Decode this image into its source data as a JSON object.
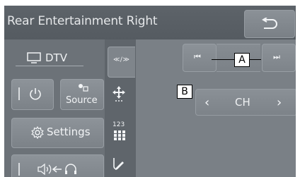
{
  "header": {
    "title": "Rear Entertainment Right",
    "back_icon": "return-arrow-icon"
  },
  "left_panel": {
    "source_name": "DTV",
    "source_icon": "monitor-icon",
    "power_icon": "power-icon",
    "source_button_label": "Source",
    "settings_label": "Settings",
    "settings_icon": "gear-icon",
    "audio_icon": "speaker-to-headphones-icon"
  },
  "middle_column": {
    "active_tab_label": "≪/≫",
    "move_icon": "move-arrows-icon",
    "keypad_label": "123",
    "edit_icon": "touch-pencil-icon"
  },
  "right_panel": {
    "skip_prev_label": "⏮",
    "skip_next_label": "⏭",
    "channel_label": "CH",
    "channel_prev_label": "‹",
    "channel_next_label": "›"
  },
  "callouts": {
    "a": "A",
    "b": "B"
  },
  "colors": {
    "screen_bg": "#757b81",
    "header_bg": "#5d6369",
    "button_bg": "#8d9399",
    "text": "#f2f4f6"
  }
}
